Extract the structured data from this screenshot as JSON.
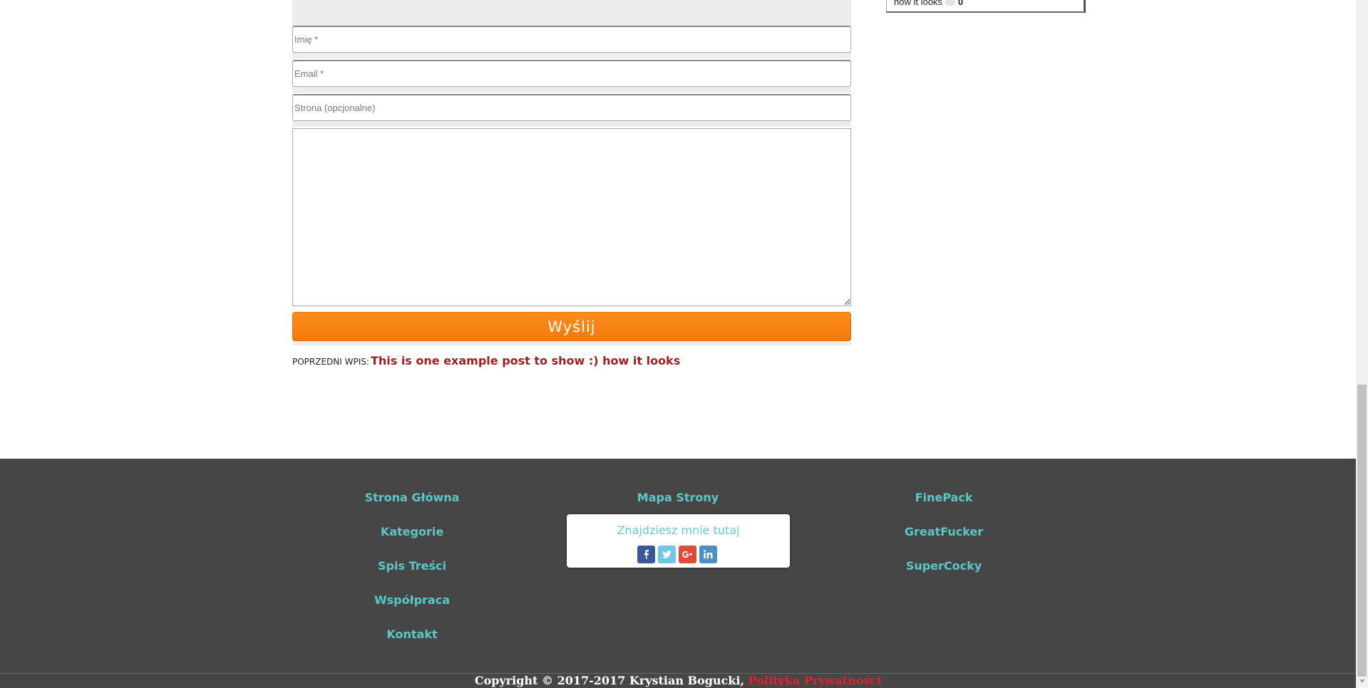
{
  "comment_form": {
    "name_placeholder": "Imię *",
    "email_placeholder": "Email *",
    "website_placeholder": "Strona (opcjonalne)",
    "submit_label": "Wyślij"
  },
  "post_nav": {
    "previous_label": "POPRZEDNI WPIS:",
    "previous_title": "This is one example post to show :) how it looks"
  },
  "sidebar_widget": {
    "text": "how it looks",
    "count": "0"
  },
  "footer": {
    "nav_left": [
      "Strona Główna",
      "Kategorie",
      "Spis Treści",
      "Współpraca",
      "Kontakt"
    ],
    "nav_center": [
      "Mapa Strony"
    ],
    "nav_right": [
      "FinePack",
      "GreatFucker",
      "SuperCocky"
    ],
    "social_title": "Znajdziesz mnie tutaj",
    "social_icons": [
      "facebook-icon",
      "twitter-icon",
      "google-plus-icon",
      "linkedin-icon"
    ],
    "copyright_text": "Copyright © 2017-2017 Krystian Bogucki,",
    "privacy_link": "Polityka Prywatności"
  },
  "colors": {
    "accent_orange": "#f7830f",
    "link_teal": "#5cc7c7",
    "post_link_red": "#a11f1f",
    "privacy_red": "#e3202b",
    "footer_bg": "#464646"
  }
}
